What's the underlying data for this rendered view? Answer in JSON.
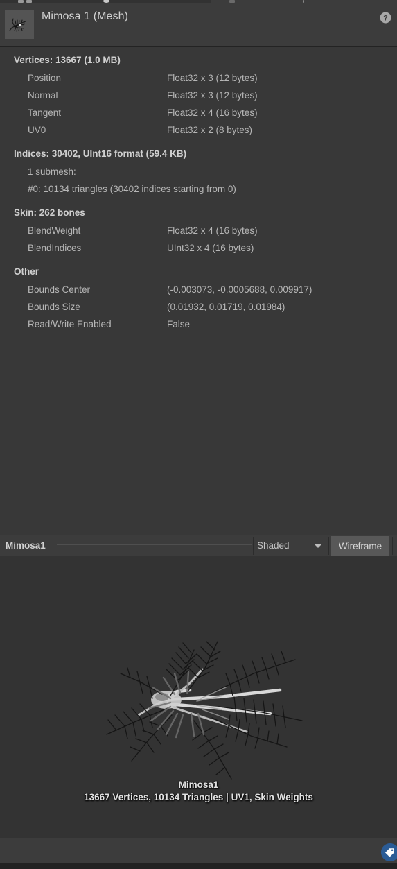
{
  "window": {
    "tabs": [
      {
        "label": "",
        "icon": "hierarchy-icon",
        "state": "inactive"
      },
      {
        "label": "",
        "icon": "project-icon",
        "state": "inactive"
      },
      {
        "label": "",
        "icon": "inspector-icon",
        "state": "active"
      }
    ]
  },
  "header": {
    "title": "Mimosa 1 (Mesh)",
    "thumbnail_icon": "mesh-thumbnail",
    "help_icon": "help-icon",
    "help_label": "?"
  },
  "info": {
    "groups": [
      {
        "title": "Vertices: 13667 (1.0 MB)",
        "rows": [
          {
            "label": "Position",
            "value": "Float32 x 3 (12 bytes)"
          },
          {
            "label": "Normal",
            "value": "Float32 x 3 (12 bytes)"
          },
          {
            "label": "Tangent",
            "value": "Float32 x 4 (16 bytes)"
          },
          {
            "label": "UV0",
            "value": "Float32 x 2 (8 bytes)"
          }
        ]
      },
      {
        "title": "Indices: 30402, UInt16 format (59.4 KB)",
        "wide_rows": [
          "1 submesh:",
          "#0: 10134 triangles (30402 indices starting from 0)"
        ]
      },
      {
        "title": "Skin: 262 bones",
        "rows": [
          {
            "label": "BlendWeight",
            "value": "Float32 x 4 (16 bytes)"
          },
          {
            "label": "BlendIndices",
            "value": "UInt32 x 4 (16 bytes)"
          }
        ]
      },
      {
        "title": "Other",
        "rows": [
          {
            "label": "Bounds Center",
            "value": "(-0.003073, -0.0005688, 0.009917)"
          },
          {
            "label": "Bounds Size",
            "value": "(0.01932, 0.01719, 0.01984)"
          },
          {
            "label": "Read/Write Enabled",
            "value": "False"
          }
        ]
      }
    ]
  },
  "preview_toolbar": {
    "name": "Mimosa1",
    "shading_mode": "Shaded",
    "dropdown_icon": "chevron-down-icon",
    "wireframe_label": "Wireframe"
  },
  "preview": {
    "mesh_name": "Mimosa1",
    "stats": "13667 Vertices, 10134 Triangles | UV1, Skin Weights"
  },
  "statusbar": {
    "badge_icon": "tag-icon"
  },
  "colors": {
    "panel_bg": "#383838",
    "header_bg": "#3c3c3c",
    "preview_bg": "#333333",
    "text": "#b6b6b6",
    "text_bold": "#d0d0d0",
    "badge_blue": "#2b5c96",
    "button_active": "#585858"
  }
}
